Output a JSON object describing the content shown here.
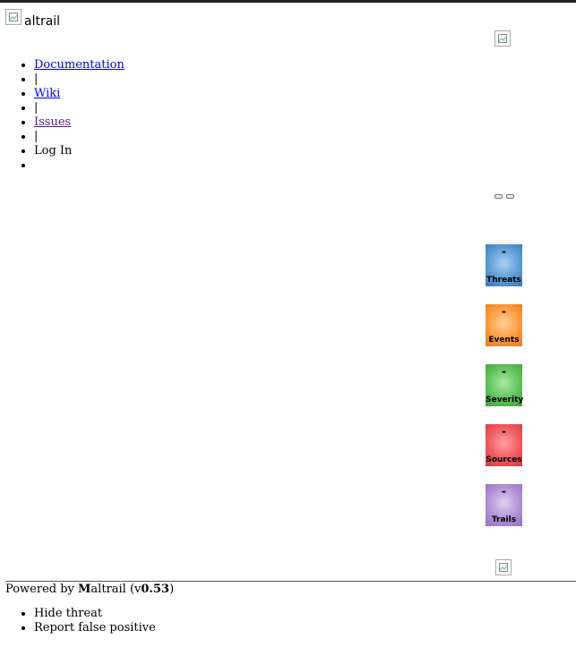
{
  "header": {
    "logo_rest": "altrail"
  },
  "nav": {
    "items": [
      "Documentation",
      "|",
      "Wiki",
      "|",
      "Issues",
      "|",
      "Log In",
      ""
    ]
  },
  "stats": [
    {
      "value": "-",
      "label": "Threats"
    },
    {
      "value": "-",
      "label": "Events"
    },
    {
      "value": "-",
      "label": "Severity"
    },
    {
      "value": "-",
      "label": "Sources"
    },
    {
      "value": "-",
      "label": "Trails"
    }
  ],
  "footer": {
    "prefix": "Powered by ",
    "brand_initial": "M",
    "brand_rest": "altrail (v",
    "version": "0.53",
    "suffix": ")"
  },
  "context_menu": {
    "items": [
      "Hide threat",
      "Report false positive"
    ]
  }
}
